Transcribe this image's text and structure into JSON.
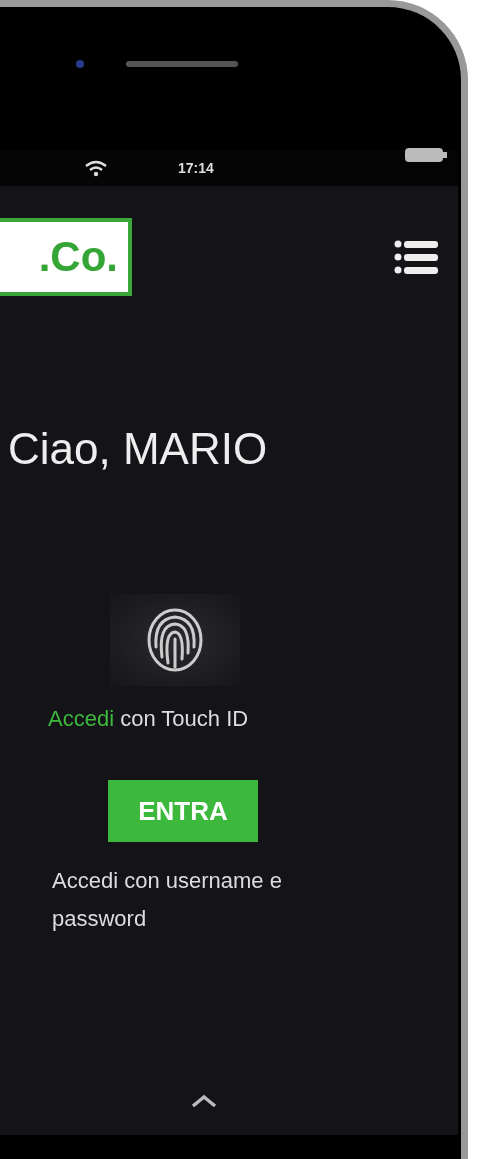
{
  "status_bar": {
    "time": "17:14"
  },
  "header": {
    "logo": ".Co."
  },
  "greeting": "Ciao, MARIO",
  "touch_id": {
    "link": "Accedi",
    "text": "con Touch ID"
  },
  "enter_button": "ENTRA",
  "password_login": "Accedi con username e password"
}
